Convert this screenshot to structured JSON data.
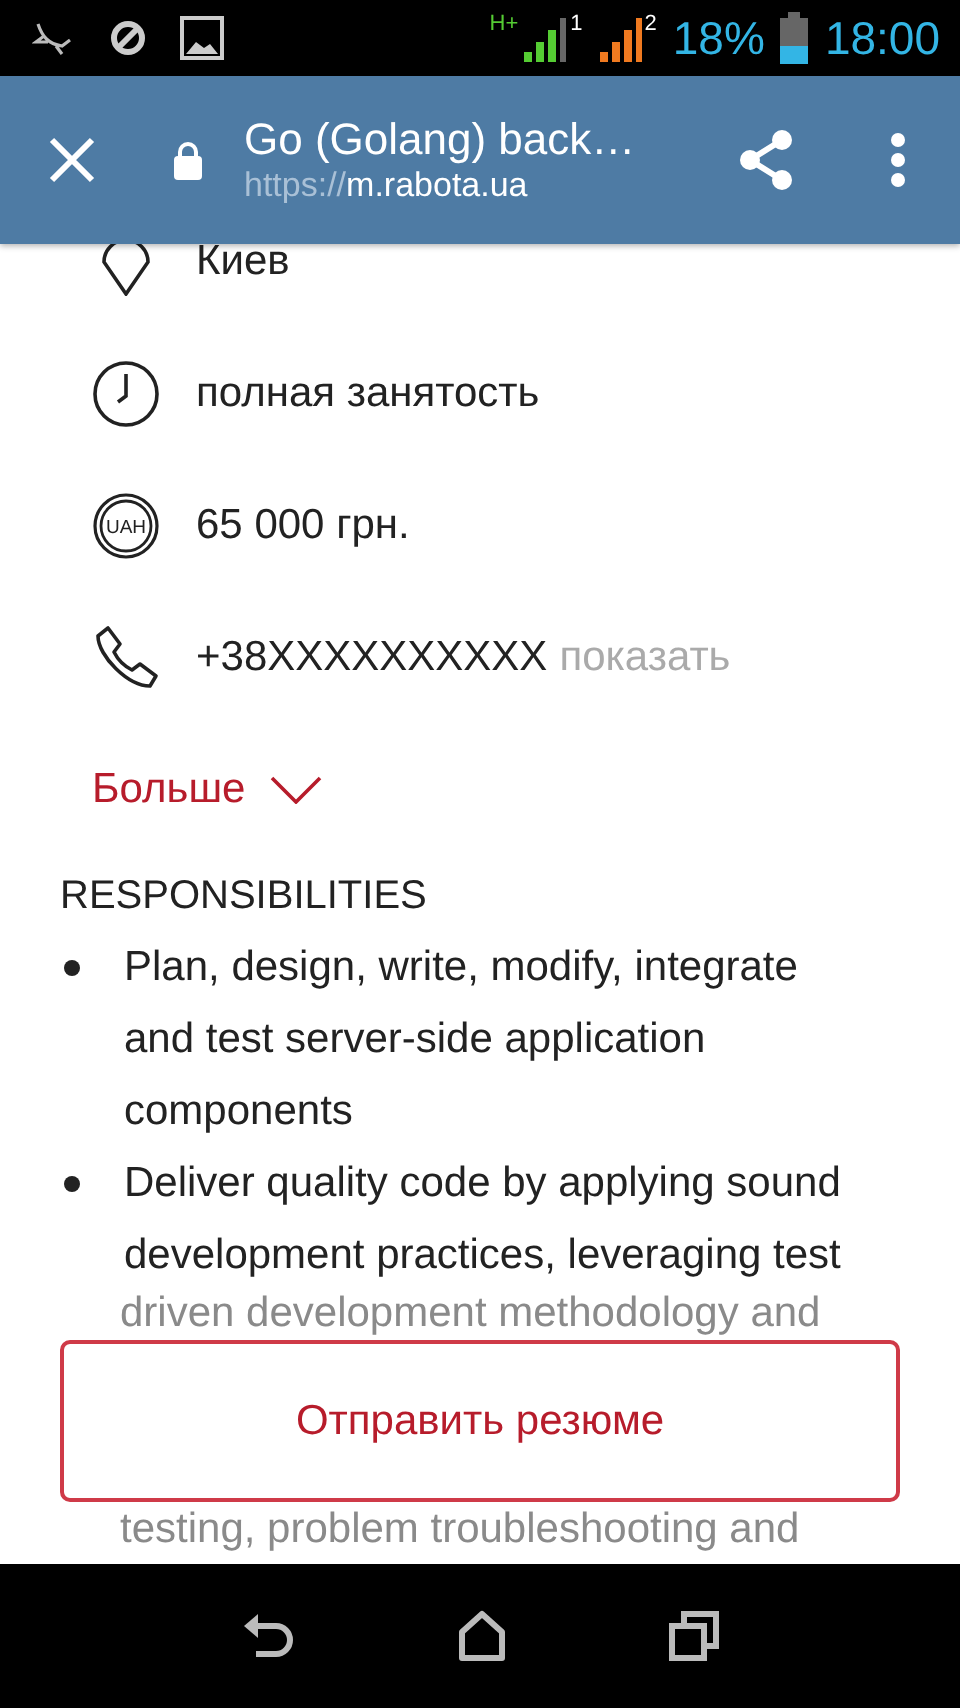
{
  "status_bar": {
    "network_label": "H+",
    "sim_1": "1",
    "sim_2": "2",
    "battery": "18%",
    "time": "18:00"
  },
  "toolbar": {
    "title": "Go (Golang) back…",
    "url_scheme": "https://",
    "url_host": "m.rabota.ua"
  },
  "details": [
    {
      "kind": "location",
      "text": "Киев"
    },
    {
      "kind": "clock",
      "text": "полная занятость"
    },
    {
      "kind": "salary",
      "icon_text": "UAH",
      "text": "65 000 грн."
    },
    {
      "kind": "phone",
      "text": "+38XXXXXXXXXX",
      "action": "показать"
    }
  ],
  "more_link": "Больше",
  "section_title": "RESPONSIBILITIES",
  "bullets": [
    {
      "text": "Plan, design, write, modify, integrate and test server-side application components"
    },
    {
      "text": "Deliver quality code by applying sound development practices, leveraging test"
    }
  ],
  "faded_lines": [
    "driven development methodology and",
    "testing, problem troubleshooting and"
  ],
  "apply_button": "Отправить резюме"
}
